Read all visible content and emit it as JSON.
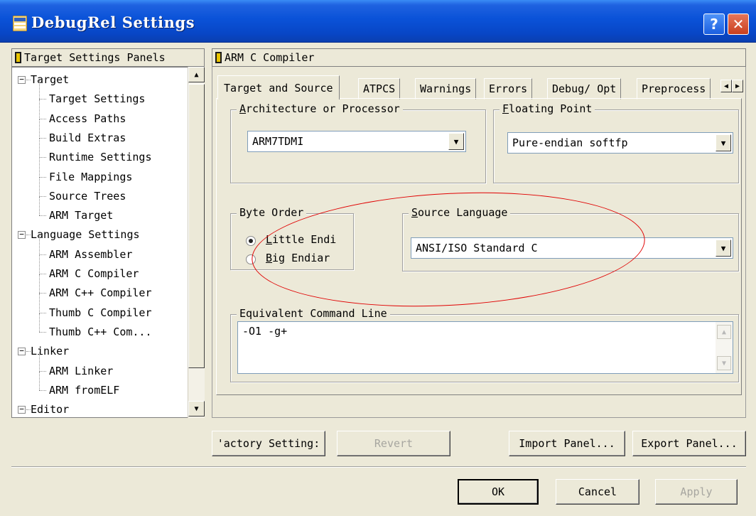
{
  "window": {
    "title": "DebugRel Settings",
    "help_label": "?",
    "close_label": "✕"
  },
  "tree": {
    "header": "Target Settings Panels",
    "items": [
      {
        "label": "Target",
        "level": 0
      },
      {
        "label": "Target Settings",
        "level": 1
      },
      {
        "label": "Access Paths",
        "level": 1
      },
      {
        "label": "Build Extras",
        "level": 1
      },
      {
        "label": "Runtime Settings",
        "level": 1
      },
      {
        "label": "File Mappings",
        "level": 1
      },
      {
        "label": "Source Trees",
        "level": 1
      },
      {
        "label": "ARM Target",
        "level": 1
      },
      {
        "label": "Language Settings",
        "level": 0
      },
      {
        "label": "ARM Assembler",
        "level": 1
      },
      {
        "label": "ARM C Compiler",
        "level": 1
      },
      {
        "label": "ARM C++ Compiler",
        "level": 1
      },
      {
        "label": "Thumb C Compiler",
        "level": 1
      },
      {
        "label": "Thumb C++ Com...",
        "level": 1
      },
      {
        "label": "Linker",
        "level": 0
      },
      {
        "label": "ARM Linker",
        "level": 1
      },
      {
        "label": "ARM fromELF",
        "level": 1
      },
      {
        "label": "Editor",
        "level": 0
      }
    ]
  },
  "panel": {
    "title": "ARM C Compiler",
    "tabs": [
      "Target and Source",
      "ATPCS",
      "Warnings",
      "Errors",
      "Debug/ Opt",
      "Preprocess"
    ],
    "arch_group": "Architecture or Processor",
    "arch_value": "ARM7TDMI",
    "fp_group": "Floating Point",
    "fp_value": "Pure-endian softfp",
    "byte_order_group": "Byte Order",
    "little_endian": "Little Endi",
    "big_endian": "Big Endiar",
    "source_lang_group": "Source Language",
    "source_lang_value": "ANSI/ISO Standard C",
    "cmdline_group": "Equivalent Command Line",
    "cmdline_value": "-O1 -g+"
  },
  "buttons": {
    "factory": "'actory Setting:",
    "revert": "Revert",
    "import": "Import Panel...",
    "export": "Export Panel...",
    "ok": "OK",
    "cancel": "Cancel",
    "apply": "Apply"
  },
  "colors": {
    "title_bar": "#0a52d8",
    "dialog_bg": "#ece9d8",
    "highlight_ellipse": "#e00000"
  }
}
